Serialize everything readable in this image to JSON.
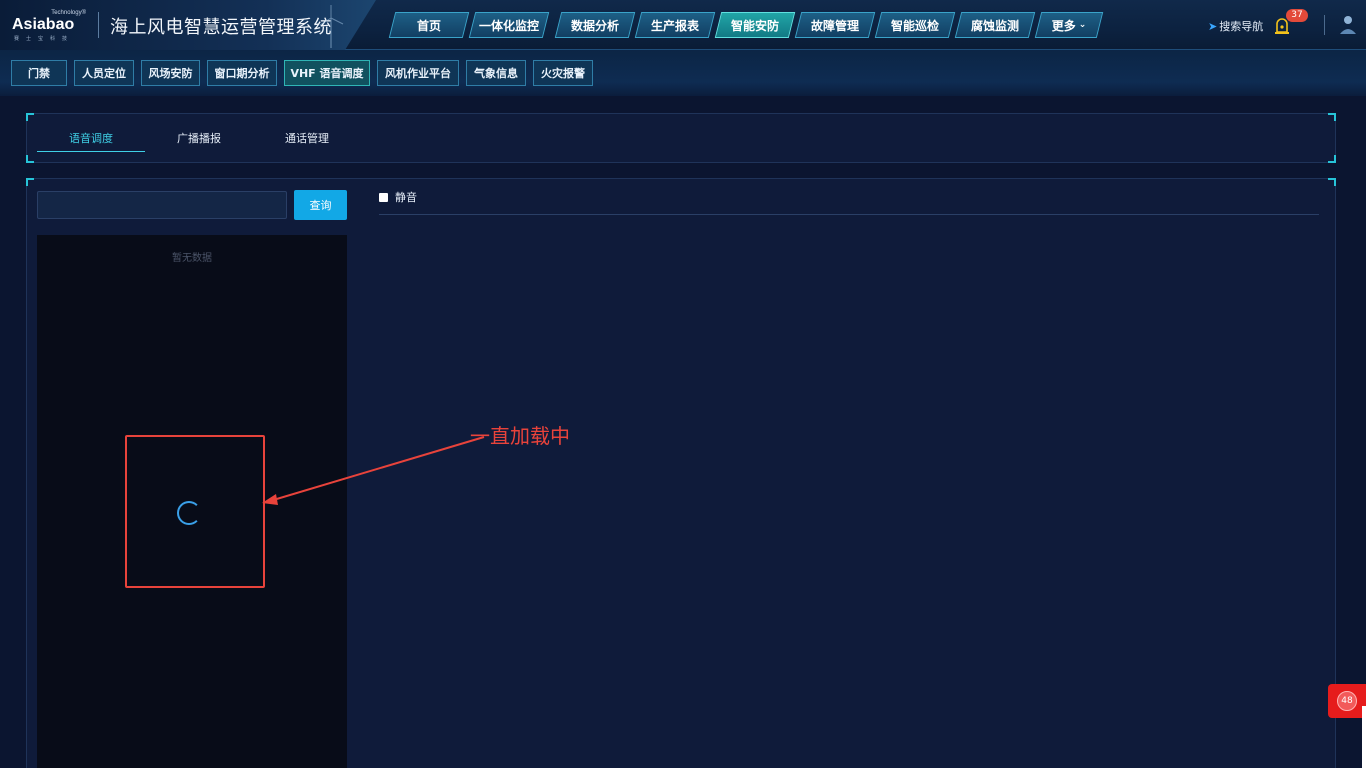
{
  "header": {
    "logo": {
      "tech": "Technology®",
      "brand": "Asiabao",
      "sub": "赛士宝科技"
    },
    "title": "海上风电智慧运营管理系统",
    "nav": [
      {
        "label": "首页"
      },
      {
        "label": "一体化监控"
      },
      {
        "label": "数据分析"
      },
      {
        "label": "生产报表"
      },
      {
        "label": "智能安防",
        "active": true
      },
      {
        "label": "故障管理"
      },
      {
        "label": "智能巡检"
      },
      {
        "label": "腐蚀监测"
      },
      {
        "label": "更多"
      }
    ],
    "search_nav": "搜索导航",
    "alarm_count": "37"
  },
  "subnav": [
    {
      "label": "门禁"
    },
    {
      "label": "人员定位"
    },
    {
      "label": "风场安防"
    },
    {
      "label": "窗口期分析"
    },
    {
      "label": "VHF 语音调度",
      "active": true
    },
    {
      "label": "风机作业平台"
    },
    {
      "label": "气象信息"
    },
    {
      "label": "火灾报警"
    }
  ],
  "tabs": [
    {
      "label": "语音调度",
      "active": true
    },
    {
      "label": "广播播报"
    },
    {
      "label": "通话管理"
    }
  ],
  "left": {
    "search_value": "",
    "query_label": "查询",
    "empty_text": "暂无数据"
  },
  "right": {
    "mute_label": "静音",
    "mute_checked": false
  },
  "annotation": {
    "text": "一直加载中"
  },
  "float_widget": {
    "count": "48"
  },
  "colors": {
    "accent_cyan": "#3fd0e6",
    "button_blue": "#12a8e6",
    "annotation_red": "#e8433b",
    "badge_red": "#e34a3a"
  }
}
